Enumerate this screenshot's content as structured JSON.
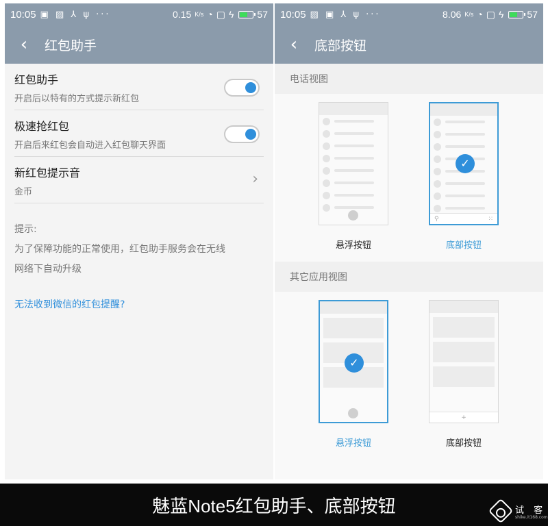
{
  "left": {
    "status": {
      "time": "10:05",
      "icons": "▣ ▨ ⅄ ψ ···",
      "speed": "0.15",
      "speed_unit": "K/s",
      "battery": "57"
    },
    "title": "红包助手",
    "settings": [
      {
        "title": "红包助手",
        "subtitle": "开启后以特有的方式提示新红包",
        "toggle": true
      },
      {
        "title": "极速抢红包",
        "subtitle": "开启后来红包会自动进入红包聊天界面",
        "toggle": true
      },
      {
        "title": "新红包提示音",
        "subtitle": "金币",
        "chevron": true
      }
    ],
    "tips_label": "提示:",
    "tips_text_line1": "为了保障功能的正常使用，红包助手服务会在无线",
    "tips_text_line2": "网络下自动升级",
    "link": "无法收到微信的红包提醒?"
  },
  "right": {
    "status": {
      "time": "10:05",
      "icons": "▨ ▣ ⅄ ψ ···",
      "speed": "8.06",
      "speed_unit": "K/s",
      "battery": "57"
    },
    "title": "底部按钮",
    "section1": {
      "header": "电话视图",
      "option1": "悬浮按钮",
      "option2": "底部按钮",
      "selected": "底部按钮"
    },
    "section2": {
      "header": "其它应用视图",
      "option1": "悬浮按钮",
      "option2": "底部按钮",
      "selected": "悬浮按钮"
    }
  },
  "banner": {
    "caption": "魅蓝Note5红包助手、底部按钮",
    "brand": "试 客",
    "domain": "shike.it168.com"
  },
  "colors": {
    "accent": "#2f8fdb",
    "titlebar": "#8b9bab",
    "banner": "#0a0a0a"
  }
}
